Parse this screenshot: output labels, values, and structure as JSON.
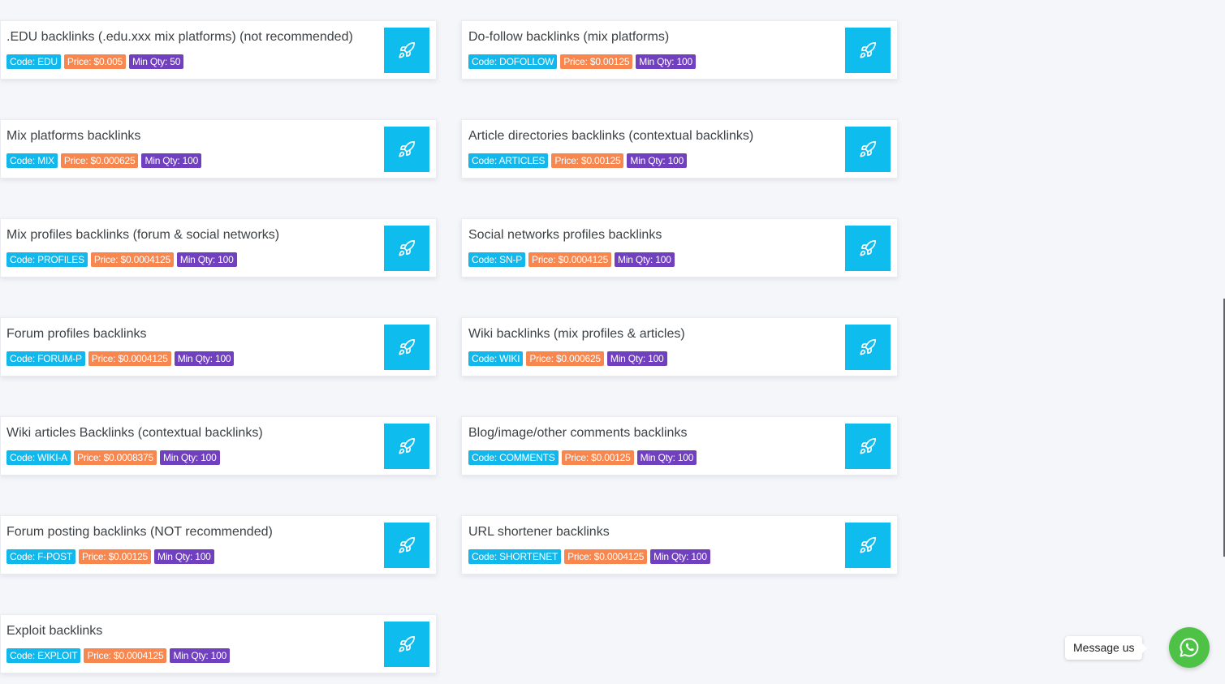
{
  "services": [
    {
      "title": ".EDU backlinks (.edu.xxx mix platforms) (not recommended)",
      "code": "Code: EDU",
      "price": "Price: $0.005",
      "min_qty": "Min Qty: 50"
    },
    {
      "title": "Do-follow backlinks (mix platforms)",
      "code": "Code: DOFOLLOW",
      "price": "Price: $0.00125",
      "min_qty": "Min Qty: 100"
    },
    {
      "title": "Mix platforms backlinks",
      "code": "Code: MIX",
      "price": "Price: $0.000625",
      "min_qty": "Min Qty: 100"
    },
    {
      "title": "Article directories backlinks (contextual backlinks)",
      "code": "Code: ARTICLES",
      "price": "Price: $0.00125",
      "min_qty": "Min Qty: 100"
    },
    {
      "title": "Mix profiles backlinks (forum & social networks)",
      "code": "Code: PROFILES",
      "price": "Price: $0.0004125",
      "min_qty": "Min Qty: 100"
    },
    {
      "title": "Social networks profiles backlinks",
      "code": "Code: SN-P",
      "price": "Price: $0.0004125",
      "min_qty": "Min Qty: 100"
    },
    {
      "title": "Forum profiles backlinks",
      "code": "Code: FORUM-P",
      "price": "Price: $0.0004125",
      "min_qty": "Min Qty: 100"
    },
    {
      "title": "Wiki backlinks (mix profiles & articles)",
      "code": "Code: WIKI",
      "price": "Price: $0.000625",
      "min_qty": "Min Qty: 100"
    },
    {
      "title": "Wiki articles Backlinks (contextual backlinks)",
      "code": "Code: WIKI-A",
      "price": "Price: $0.0008375",
      "min_qty": "Min Qty: 100"
    },
    {
      "title": "Blog/image/other comments backlinks",
      "code": "Code: COMMENTS",
      "price": "Price: $0.00125",
      "min_qty": "Min Qty: 100"
    },
    {
      "title": "Forum posting backlinks (NOT recommended)",
      "code": "Code: F-POST",
      "price": "Price: $0.00125",
      "min_qty": "Min Qty: 100"
    },
    {
      "title": "URL shortener backlinks",
      "code": "Code: SHORTENET",
      "price": "Price: $0.0004125",
      "min_qty": "Min Qty: 100"
    },
    {
      "title": "Exploit backlinks",
      "code": "Code: EXPLOIT",
      "price": "Price: $0.0004125",
      "min_qty": "Min Qty: 100"
    }
  ],
  "order_button_icon": "rocket-icon",
  "chat": {
    "label": "Message us",
    "icon": "whatsapp-icon"
  },
  "colors": {
    "accent": "#0ebcee",
    "code_badge": "#12b8ec",
    "price_badge": "#f8874f",
    "qty_badge": "#7040bf",
    "whatsapp": "#4dc247"
  }
}
